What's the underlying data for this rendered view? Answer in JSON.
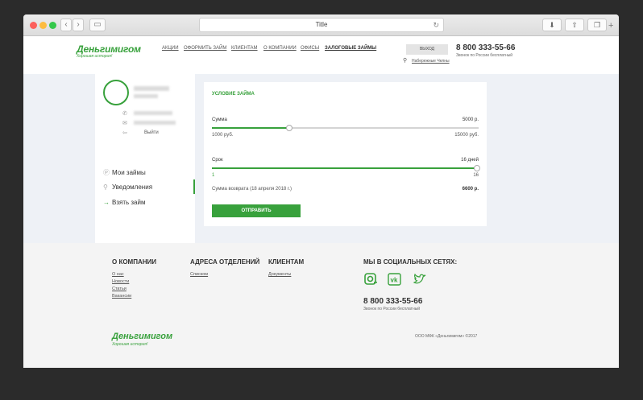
{
  "browser": {
    "title": "Title"
  },
  "header": {
    "logo": "Деньгимигом",
    "tagline": "Хорошая история!",
    "menu": [
      "АКЦИИ",
      "ОФОРМИТЬ ЗАЙМ",
      "КЛИЕНТАМ",
      "О КОМПАНИИ",
      "ОФИСЫ",
      "ЗАЛОГОВЫЕ ЗАЙМЫ"
    ],
    "exit_label": "ВЫХОД",
    "city": "Набережные Челны",
    "phone": "8 800 333-55-66",
    "phone_note": "Звонок по России бесплатный"
  },
  "sidebar": {
    "logout": "Выйти",
    "items": [
      {
        "label": "Мои займы",
        "icon": "loans-icon"
      },
      {
        "label": "Уведомления",
        "icon": "location-icon"
      },
      {
        "label": "Взять займ",
        "icon": "arrow-right-icon",
        "active": true
      }
    ]
  },
  "loan": {
    "title": "УСЛОВИЕ ЗАЙМА",
    "sum_label": "Сумма",
    "sum_value": "5000 р.",
    "sum_min": "1000 руб.",
    "sum_max": "15000 руб.",
    "sum_fraction": 0.286,
    "term_label": "Срок",
    "term_value": "16 дней",
    "term_min": "1",
    "term_max": "16",
    "term_fraction": 1.0,
    "return_label": "Сумма возврата (18 апреля 2018 г.)",
    "return_value": "6600 р.",
    "submit": "ОТПРАВИТЬ"
  },
  "footer": {
    "about_title": "О КОМПАНИИ",
    "about_links": [
      "О нас",
      "Новости",
      "Статьи",
      "Вакансии"
    ],
    "offices_title": "АДРЕСА ОТДЕЛЕНИЙ",
    "offices_link": "Списком",
    "clients_title": "КЛИЕНТАМ",
    "clients_link": "Документы",
    "social_title": "МЫ В СОЦИАЛЬНЫХ СЕТЯХ:",
    "phone": "8 800 333-55-66",
    "phone_note": "Звонок по России бесплатный",
    "logo": "Деньгимигом",
    "tagline": "Хорошая история!",
    "copyright": "ООО МФК «Деньгимигом» ©2017"
  },
  "colors": {
    "accent": "#38a13c"
  }
}
